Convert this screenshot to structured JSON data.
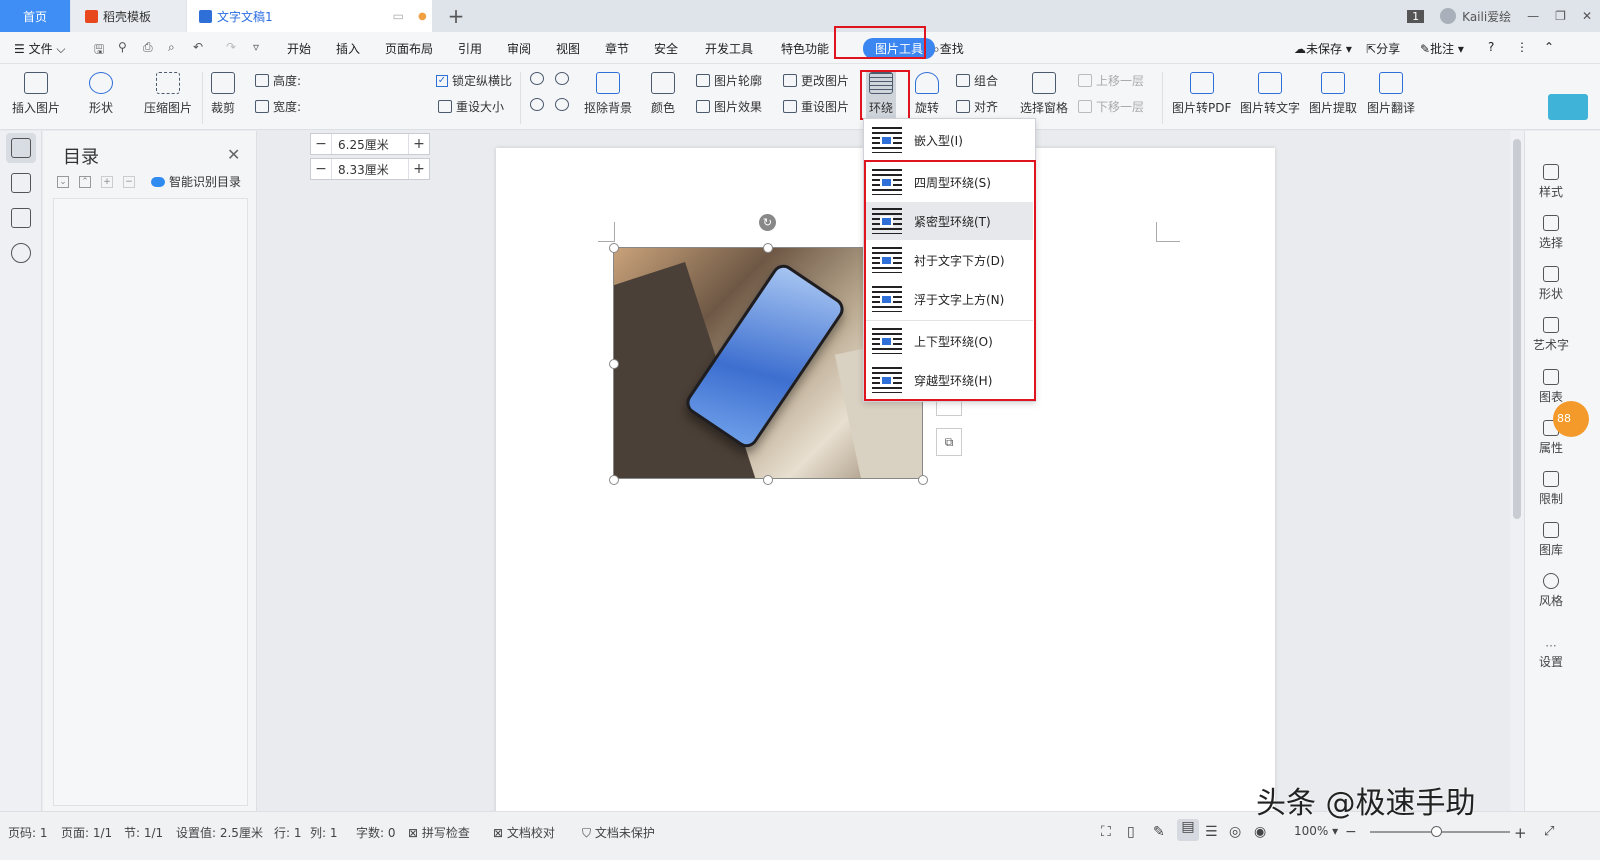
{
  "titlebar": {
    "tab_home": "首页",
    "tab_template": "稻壳模板",
    "tab_doc": "文字文稿1",
    "tab_add": "+",
    "page_badge": "1",
    "user_name": "Kaili爱绘",
    "colors": {
      "home_tab": "#3f8ef6",
      "doc_tab_text": "#2a6ee0",
      "template_icon": "#e8481e"
    }
  },
  "menubar": {
    "file": "文件",
    "items": [
      "开始",
      "插入",
      "页面布局",
      "引用",
      "审阅",
      "视图",
      "章节",
      "安全",
      "开发工具",
      "特色功能"
    ],
    "active_tab": "图片工具",
    "search": "查找",
    "right": [
      "未保存",
      "分享",
      "批注"
    ],
    "help": "?"
  },
  "ribbon": {
    "insert_picture": "插入图片",
    "shape": "形状",
    "compress": "压缩图片",
    "crop": "裁剪",
    "height_label": "高度:",
    "height_value": "6.25厘米",
    "width_label": "宽度:",
    "width_value": "8.33厘米",
    "lock_ratio": "锁定纵横比",
    "reset_size": "重设大小",
    "remove_bg": "抠除背景",
    "color": "颜色",
    "pic_outline": "图片轮廓",
    "pic_effect": "图片效果",
    "change_pic": "更改图片",
    "reset_pic": "重设图片",
    "wrap": "环绕",
    "rotate": "旋转",
    "group": "组合",
    "align": "对齐",
    "selection_pane": "选择窗格",
    "bring_forward": "上移一层",
    "send_backward": "下移一层",
    "to_pdf": "图片转PDF",
    "to_text": "图片转文字",
    "extract": "图片提取",
    "translate": "图片翻译"
  },
  "toc": {
    "title": "目录",
    "smart": "智能识别目录"
  },
  "wrap_menu": {
    "items": [
      {
        "label": "嵌入型(I)"
      },
      {
        "label": "四周型环绕(S)"
      },
      {
        "label": "紧密型环绕(T)"
      },
      {
        "label": "衬于文字下方(D)"
      },
      {
        "label": "浮于文字上方(N)"
      },
      {
        "label": "上下型环绕(O)"
      },
      {
        "label": "穿越型环绕(H)"
      }
    ]
  },
  "rightbar": {
    "items": [
      "样式",
      "选择",
      "形状",
      "艺术字",
      "图表",
      "属性",
      "限制",
      "图库",
      "风格",
      "设置"
    ],
    "badge": "88"
  },
  "statusbar": {
    "page_no": "页码: 1",
    "pages": "页面: 1/1",
    "section": "节: 1/1",
    "setting": "设置值: 2.5厘米",
    "row": "行: 1",
    "col": "列: 1",
    "words": "字数: 0",
    "spell": "拼写检查",
    "proof": "文档校对",
    "protect": "文档未保护",
    "zoom": "100%",
    "zoom_minus": "−",
    "zoom_plus": "+"
  },
  "watermark": "头条 @极速手助"
}
